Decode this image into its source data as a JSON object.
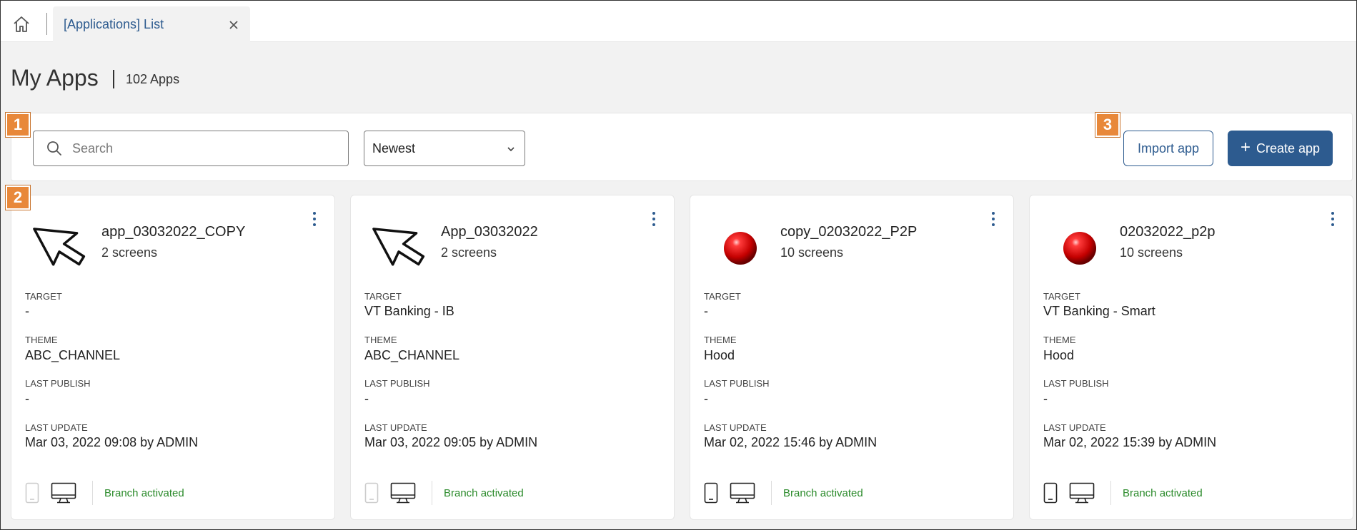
{
  "tabs": [
    {
      "label": "[Applications] List"
    }
  ],
  "header": {
    "title": "My Apps",
    "count": "102 Apps"
  },
  "toolbar": {
    "search_placeholder": "Search",
    "sort_value": "Newest",
    "import_label": "Import app",
    "create_label": "Create app"
  },
  "markers": [
    "1",
    "2",
    "3"
  ],
  "field_labels": {
    "target": "TARGET",
    "theme": "THEME",
    "last_publish": "LAST PUBLISH",
    "last_update": "LAST UPDATE"
  },
  "apps": [
    {
      "name": "app_03032022_COPY",
      "screens": "2 screens",
      "icon": "cursor-arrow-icon",
      "target": "-",
      "theme": "ABC_CHANNEL",
      "last_publish": "-",
      "last_update": "Mar 03, 2022 09:08 by ADMIN",
      "branch_status": "Branch activated",
      "mobile_enabled": false
    },
    {
      "name": "App_03032022",
      "screens": "2 screens",
      "icon": "cursor-arrow-icon",
      "target": "VT Banking - IB",
      "theme": "ABC_CHANNEL",
      "last_publish": "-",
      "last_update": "Mar 03, 2022 09:05 by ADMIN",
      "branch_status": "Branch activated",
      "mobile_enabled": false
    },
    {
      "name": "copy_02032022_P2P",
      "screens": "10 screens",
      "icon": "red-ball-icon",
      "target": "-",
      "theme": "Hood",
      "last_publish": "-",
      "last_update": "Mar 02, 2022 15:46 by ADMIN",
      "branch_status": "Branch activated",
      "mobile_enabled": true
    },
    {
      "name": "02032022_p2p",
      "screens": "10 screens",
      "icon": "red-ball-icon",
      "target": "VT Banking - Smart",
      "theme": "Hood",
      "last_publish": "-",
      "last_update": "Mar 02, 2022 15:39 by  ADMIN",
      "branch_status": "Branch activated",
      "mobile_enabled": true
    }
  ],
  "colors": {
    "accent": "#2d5b8f",
    "marker": "#e8883a",
    "branch_status": "#2a8a2a",
    "page_background": "#f2f2f2"
  }
}
